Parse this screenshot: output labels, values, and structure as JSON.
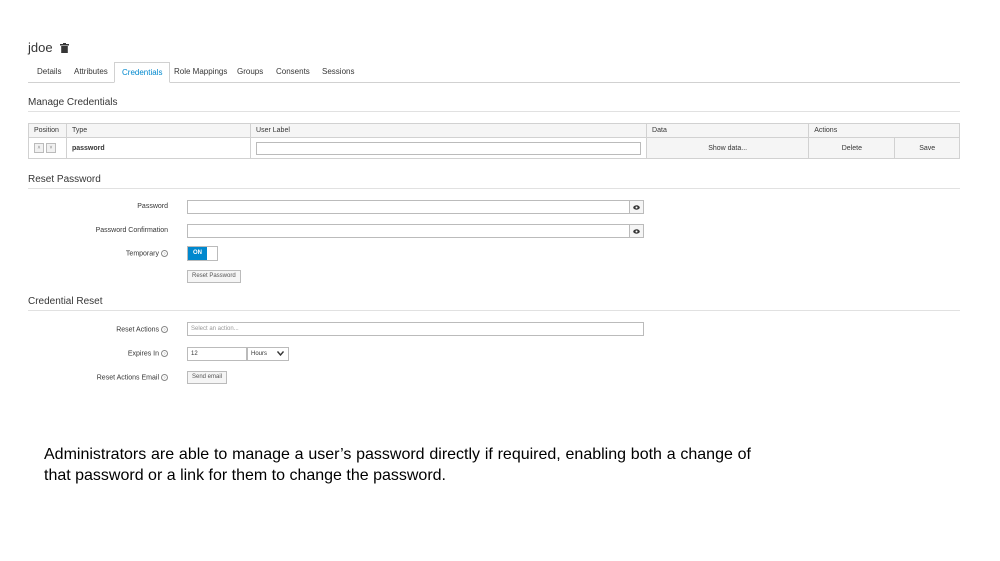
{
  "header": {
    "title": "jdoe"
  },
  "tabs": [
    {
      "label": "Details"
    },
    {
      "label": "Attributes"
    },
    {
      "label": "Credentials"
    },
    {
      "label": "Role Mappings"
    },
    {
      "label": "Groups"
    },
    {
      "label": "Consents"
    },
    {
      "label": "Sessions"
    }
  ],
  "manage": {
    "title": "Manage Credentials",
    "columns": {
      "position": "Position",
      "type": "Type",
      "user_label": "User Label",
      "data": "Data",
      "actions": "Actions"
    },
    "row": {
      "up": "˄",
      "down": "˅",
      "type": "password",
      "user_label_value": "",
      "show_data": "Show data...",
      "delete": "Delete",
      "save": "Save"
    }
  },
  "reset": {
    "title": "Reset Password",
    "password_label": "Password",
    "password_value": "",
    "confirm_label": "Password Confirmation",
    "confirm_value": "",
    "temporary_label": "Temporary",
    "temporary_state": "ON",
    "reset_button": "Reset Password"
  },
  "credential_reset": {
    "title": "Credential Reset",
    "actions_label": "Reset Actions",
    "actions_placeholder": "Select an action...",
    "expires_label": "Expires In",
    "expires_value": "12",
    "expires_unit": "Hours",
    "email_label": "Reset Actions Email",
    "send_email": "Send email"
  },
  "caption": "Administrators are able to manage a user’s password directly if required, enabling both a change of that password or a link for them to change the password.",
  "colors": {
    "accent": "#0088ce",
    "border": "#d1d1d1",
    "header_bg": "#f5f5f5"
  }
}
